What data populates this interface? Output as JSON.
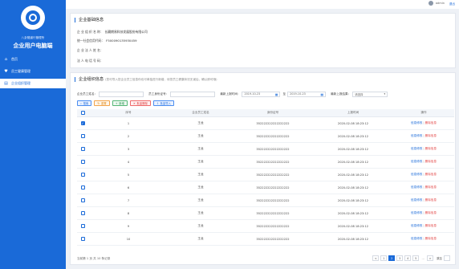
{
  "sidebar": {
    "subtitle": "八卦隧道行管理所",
    "title": "企业用户电脑端",
    "items": [
      {
        "label": "首页",
        "icon": "home-icon"
      },
      {
        "label": "员工健康管理",
        "icon": "heart-icon"
      },
      {
        "label": "企业组织管理",
        "icon": "org-icon"
      }
    ]
  },
  "topbar": {
    "user": "admin",
    "logout": "退出"
  },
  "info": {
    "title": "企业基础信息",
    "company_name_label": "企 业 组 织 名 称：",
    "company_name": "长藏朗易科技发展股份有限公司",
    "credit_code_label": "统一社会信用代码：",
    "credit_code": "F500090135930459",
    "legal_person_label": "企 业 法 人 姓 名：",
    "legal_phone_label": "法 人 电 话 号 码："
  },
  "org": {
    "title": "企业组织信息",
    "note": "(您可导入您企业员工信息你也可单独进行新增，待您员工健康状况无误后，确认即可哦)",
    "filters": {
      "name_label": "企业员工姓名：",
      "id_label": "员工身份证号：",
      "time_label": "最新上报时间：",
      "date_from": "2019-10-23",
      "date_to": "2019-10-23",
      "range_sep": "至",
      "status_label": "最新上报结果：",
      "status_placeholder": "请选择"
    },
    "buttons": {
      "query": "搜索",
      "reset": "重置",
      "add": "新增",
      "batch_delete": "批量删除",
      "batch_import": "批量导入"
    },
    "columns": [
      "序号",
      "企业员工姓名",
      "身份证号",
      "上报时间",
      "操作"
    ],
    "rows": [
      {
        "no": "1",
        "name": "王龙",
        "id": "352222222222222222",
        "time": "2020-02-08 18:23:12",
        "checked": true
      },
      {
        "no": "2",
        "name": "王龙",
        "id": "352222222222222222",
        "time": "2020-02-08 18:23:12",
        "checked": false
      },
      {
        "no": "3",
        "name": "王龙",
        "id": "352222222222222222",
        "time": "2020-02-08 18:23:12",
        "checked": false
      },
      {
        "no": "4",
        "name": "王龙",
        "id": "352222222222222222",
        "time": "2020-02-08 18:23:12",
        "checked": false
      },
      {
        "no": "5",
        "name": "王龙",
        "id": "352222222222222222",
        "time": "2020-02-08 18:23:12",
        "checked": false
      },
      {
        "no": "6",
        "name": "王龙",
        "id": "352222222222222222",
        "time": "2020-02-08 18:23:12",
        "checked": false
      },
      {
        "no": "7",
        "name": "王龙",
        "id": "352222222222222222",
        "time": "2020-02-08 18:23:12",
        "checked": false
      },
      {
        "no": "8",
        "name": "王龙",
        "id": "352222222222222222",
        "time": "2020-02-08 18:23:12",
        "checked": false
      },
      {
        "no": "9",
        "name": "王龙",
        "id": "352222222222222222",
        "time": "2020-02-08 18:23:12",
        "checked": false
      },
      {
        "no": "10",
        "name": "王龙",
        "id": "352222222222222222",
        "time": "2020-02-08 18:23:12",
        "checked": false
      }
    ],
    "op_view": "信息修改",
    "op_delete": "删除信息",
    "op_sep": "|",
    "pager_info": "当前第 1 页 共 10 条记录",
    "pages": [
      "1",
      "2",
      "3",
      "4",
      "5"
    ],
    "prev": "<",
    "next": ">",
    "ellipsis": "...",
    "goto_label": "跳至"
  },
  "colors": {
    "primary": "#1a6ad8",
    "danger": "#e34848"
  }
}
